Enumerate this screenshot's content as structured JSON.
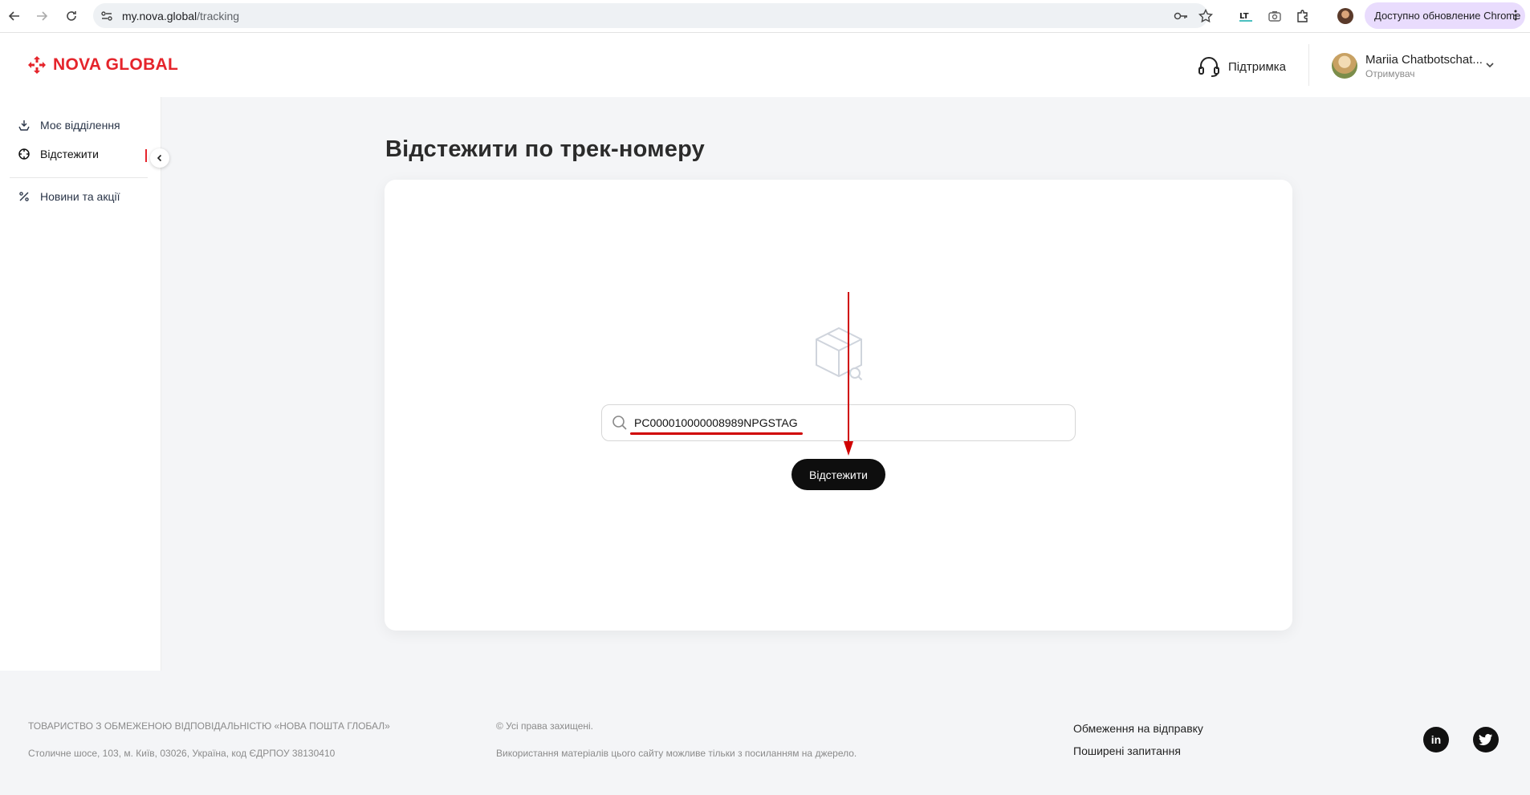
{
  "browser": {
    "url_host": "my.nova.global",
    "url_path": "/tracking",
    "update_label": "Доступно обновление Chrome"
  },
  "header": {
    "logo_text": "NOVA GLOBAL",
    "support_label": "Підтримка",
    "user_name": "Mariia Chatbotschat...",
    "user_role": "Отримувач"
  },
  "sidebar": {
    "items": [
      {
        "label": "Моє відділення",
        "icon": "home-icon"
      },
      {
        "label": "Відстежити",
        "icon": "target-icon",
        "active": true
      },
      {
        "label": "Новини та акції",
        "icon": "percent-icon"
      }
    ]
  },
  "main": {
    "title": "Відстежити по трек-номеру",
    "search_value": "PC000010000008989NPGSTAG",
    "track_button": "Відстежити"
  },
  "footer": {
    "company": "ТОВАРИСТВО З ОБМЕЖЕНОЮ ВІДПОВІДАЛЬНІСТЮ «НОВА ПОШТА ГЛОБАЛ»",
    "address": "Столичне шосе, 103, м. Київ, 03026, Україна, код ЄДРПОУ 38130410",
    "copyright": "© Усі права захищені.",
    "usage_note": "Використання матеріалів цього сайту можливе тільки з посиланням на джерело.",
    "links": [
      "Обмеження на відправку",
      "Поширені запитання"
    ],
    "social": [
      "linkedin-icon",
      "twitter-icon"
    ]
  },
  "colors": {
    "brand_red": "#e5242b",
    "button_dark": "#0e0e0e",
    "annotation_red": "#d00000",
    "update_pill": "#e9dcfd"
  }
}
